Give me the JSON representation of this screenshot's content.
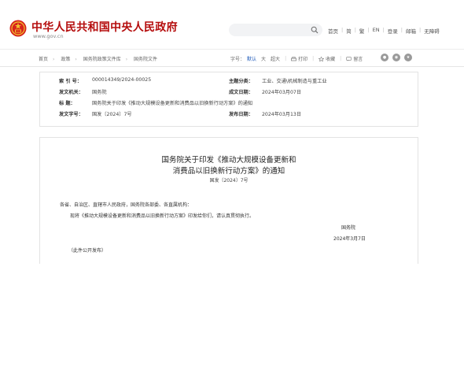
{
  "header": {
    "site_title": "中华人民共和国中央人民政府",
    "site_domain": "www.gov.cn",
    "search_placeholder": "",
    "links": [
      "首页",
      "简",
      "繁",
      "EN",
      "登录",
      "邮箱",
      "无障碍"
    ]
  },
  "breadcrumb": [
    "首页",
    "政策",
    "国务院政策文件库",
    "国务院文件"
  ],
  "tools": {
    "font_label": "字号：",
    "font_current": "默认",
    "font_big": "大",
    "font_bigger": "超大",
    "print_label": "打印",
    "fav_label": "收藏",
    "msg_label": "留言"
  },
  "share_icons": [
    "wechat-share-icon",
    "weibo-share-icon",
    "qzone-share-icon"
  ],
  "meta": {
    "index_label": "索  引  号：",
    "index_value": "000014349/2024-00025",
    "topic_label": "主题分类：",
    "topic_value": "工业、交通\\机械制造与重工业",
    "issuer_label": "发文机关：",
    "issuer_value": "国务院",
    "written_label": "成文日期：",
    "written_value": "2024年03月07日",
    "title_label": "标      题：",
    "title_value": "国务院关于印发《推动大规模设备更新和消费品以旧换新行动方案》的通知",
    "docnum_label": "发文字号：",
    "docnum_value": "国发〔2024〕7号",
    "pub_label": "发布日期：",
    "pub_value": "2024年03月13日"
  },
  "doc": {
    "title_line1": "国务院关于印发《推动大规模设备更新和",
    "title_line2": "消费品以旧换新行动方案》的通知",
    "number": "国发〔2024〕7号",
    "salutation": "各省、自治区、直辖市人民政府，国务院各部委、各直属机构：",
    "body": "现将《推动大规模设备更新和消费品以旧换新行动方案》印发给你们，请认真贯彻执行。",
    "signer": "国务院",
    "date": "2024年3月7日",
    "note": "（此件公开发布）"
  },
  "colors": {
    "brand_red": "#b50d0d",
    "link_blue": "#1a56b8"
  }
}
